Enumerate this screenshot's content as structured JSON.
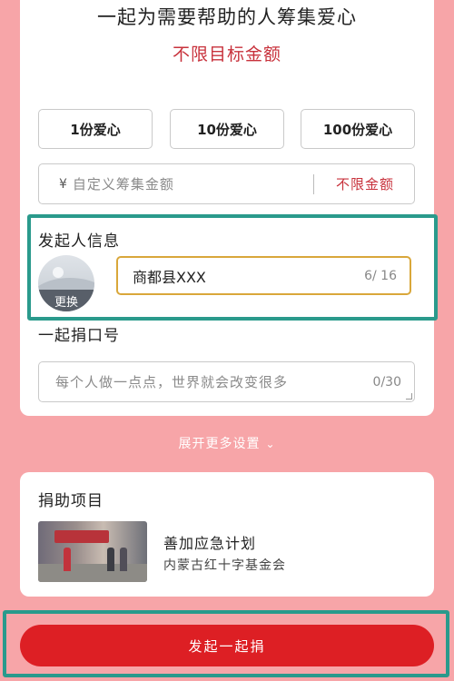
{
  "header": {
    "title": "一起为需要帮助的人筹集爱心",
    "subtitle": "不限目标金额"
  },
  "amount_options": [
    {
      "label": "1份爱心"
    },
    {
      "label": "10份爱心"
    },
    {
      "label": "100份爱心"
    }
  ],
  "custom_amount": {
    "currency": "¥",
    "placeholder": "自定义筹集金额",
    "unlimited_label": "不限金额"
  },
  "initiator": {
    "section_label": "发起人信息",
    "avatar_change_label": "更换",
    "name_value": "商都县XXX",
    "name_counter": "6/ 16"
  },
  "slogan": {
    "section_label": "一起捐口号",
    "placeholder": "每个人做一点点，世界就会改变很多",
    "counter": "0/30"
  },
  "expand_more": {
    "label": "展开更多设置",
    "icon": "chevron-down-icon"
  },
  "project": {
    "section_label": "捐助项目",
    "title": "善加应急计划",
    "org": "内蒙古红十字基金会"
  },
  "submit": {
    "label": "发起一起捐"
  },
  "colors": {
    "background": "#f7a5a8",
    "accent_red": "#dd1f24",
    "highlight_teal": "#2a9a8c",
    "input_focus": "#d9a73a"
  }
}
